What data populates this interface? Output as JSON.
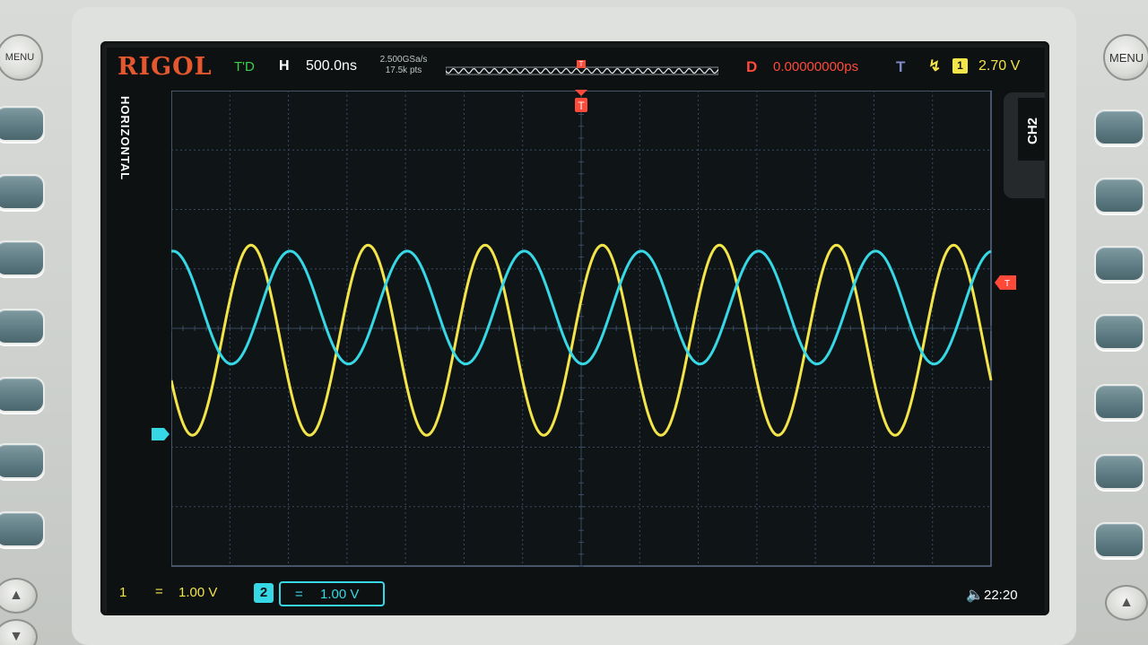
{
  "header": {
    "brand": "RIGOL",
    "trigger_status": "T'D",
    "horizontal_label": "H",
    "timebase": "500.0ns",
    "sample_rate": "2.500GSa/s",
    "memory_depth": "17.5k pts",
    "delay_label": "D",
    "delay_value": "0.00000000ps",
    "trigger_label": "T",
    "trigger_source": "1",
    "trigger_level": "2.70 V",
    "trigger_marker": "T"
  },
  "side_tabs": {
    "left": "HORIZONTAL",
    "right": "CH2"
  },
  "footer": {
    "ch1_number": "1",
    "ch1_coupling": "=",
    "ch1_scale": "1.00 V",
    "ch2_number": "2",
    "ch2_coupling": "=",
    "ch2_scale": "1.00 V",
    "clock": "22:20"
  },
  "buttons": {
    "menu_left": "MENU",
    "menu_right": "MENU"
  },
  "colors": {
    "ch1": "#f3e44a",
    "ch2": "#37d8e6",
    "trigger": "#ff4a3a",
    "brand": "#e5572e",
    "grid": "#3a4a63"
  },
  "traces": {
    "ch1": {
      "amplitude_div": 1.6,
      "offset_div": -0.2,
      "cycles": 7.0,
      "phase_deg": 205
    },
    "ch2": {
      "amplitude_div": 0.95,
      "offset_div": 0.35,
      "cycles": 7.0,
      "phase_deg": 85
    }
  }
}
